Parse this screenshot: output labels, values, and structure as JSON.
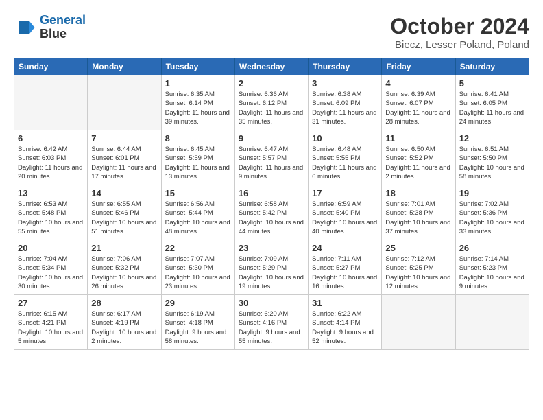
{
  "header": {
    "logo_line1": "General",
    "logo_line2": "Blue",
    "month": "October 2024",
    "location": "Biecz, Lesser Poland, Poland"
  },
  "weekdays": [
    "Sunday",
    "Monday",
    "Tuesday",
    "Wednesday",
    "Thursday",
    "Friday",
    "Saturday"
  ],
  "weeks": [
    [
      {
        "day": "",
        "info": ""
      },
      {
        "day": "",
        "info": ""
      },
      {
        "day": "1",
        "info": "Sunrise: 6:35 AM\nSunset: 6:14 PM\nDaylight: 11 hours and 39 minutes."
      },
      {
        "day": "2",
        "info": "Sunrise: 6:36 AM\nSunset: 6:12 PM\nDaylight: 11 hours and 35 minutes."
      },
      {
        "day": "3",
        "info": "Sunrise: 6:38 AM\nSunset: 6:09 PM\nDaylight: 11 hours and 31 minutes."
      },
      {
        "day": "4",
        "info": "Sunrise: 6:39 AM\nSunset: 6:07 PM\nDaylight: 11 hours and 28 minutes."
      },
      {
        "day": "5",
        "info": "Sunrise: 6:41 AM\nSunset: 6:05 PM\nDaylight: 11 hours and 24 minutes."
      }
    ],
    [
      {
        "day": "6",
        "info": "Sunrise: 6:42 AM\nSunset: 6:03 PM\nDaylight: 11 hours and 20 minutes."
      },
      {
        "day": "7",
        "info": "Sunrise: 6:44 AM\nSunset: 6:01 PM\nDaylight: 11 hours and 17 minutes."
      },
      {
        "day": "8",
        "info": "Sunrise: 6:45 AM\nSunset: 5:59 PM\nDaylight: 11 hours and 13 minutes."
      },
      {
        "day": "9",
        "info": "Sunrise: 6:47 AM\nSunset: 5:57 PM\nDaylight: 11 hours and 9 minutes."
      },
      {
        "day": "10",
        "info": "Sunrise: 6:48 AM\nSunset: 5:55 PM\nDaylight: 11 hours and 6 minutes."
      },
      {
        "day": "11",
        "info": "Sunrise: 6:50 AM\nSunset: 5:52 PM\nDaylight: 11 hours and 2 minutes."
      },
      {
        "day": "12",
        "info": "Sunrise: 6:51 AM\nSunset: 5:50 PM\nDaylight: 10 hours and 58 minutes."
      }
    ],
    [
      {
        "day": "13",
        "info": "Sunrise: 6:53 AM\nSunset: 5:48 PM\nDaylight: 10 hours and 55 minutes."
      },
      {
        "day": "14",
        "info": "Sunrise: 6:55 AM\nSunset: 5:46 PM\nDaylight: 10 hours and 51 minutes."
      },
      {
        "day": "15",
        "info": "Sunrise: 6:56 AM\nSunset: 5:44 PM\nDaylight: 10 hours and 48 minutes."
      },
      {
        "day": "16",
        "info": "Sunrise: 6:58 AM\nSunset: 5:42 PM\nDaylight: 10 hours and 44 minutes."
      },
      {
        "day": "17",
        "info": "Sunrise: 6:59 AM\nSunset: 5:40 PM\nDaylight: 10 hours and 40 minutes."
      },
      {
        "day": "18",
        "info": "Sunrise: 7:01 AM\nSunset: 5:38 PM\nDaylight: 10 hours and 37 minutes."
      },
      {
        "day": "19",
        "info": "Sunrise: 7:02 AM\nSunset: 5:36 PM\nDaylight: 10 hours and 33 minutes."
      }
    ],
    [
      {
        "day": "20",
        "info": "Sunrise: 7:04 AM\nSunset: 5:34 PM\nDaylight: 10 hours and 30 minutes."
      },
      {
        "day": "21",
        "info": "Sunrise: 7:06 AM\nSunset: 5:32 PM\nDaylight: 10 hours and 26 minutes."
      },
      {
        "day": "22",
        "info": "Sunrise: 7:07 AM\nSunset: 5:30 PM\nDaylight: 10 hours and 23 minutes."
      },
      {
        "day": "23",
        "info": "Sunrise: 7:09 AM\nSunset: 5:29 PM\nDaylight: 10 hours and 19 minutes."
      },
      {
        "day": "24",
        "info": "Sunrise: 7:11 AM\nSunset: 5:27 PM\nDaylight: 10 hours and 16 minutes."
      },
      {
        "day": "25",
        "info": "Sunrise: 7:12 AM\nSunset: 5:25 PM\nDaylight: 10 hours and 12 minutes."
      },
      {
        "day": "26",
        "info": "Sunrise: 7:14 AM\nSunset: 5:23 PM\nDaylight: 10 hours and 9 minutes."
      }
    ],
    [
      {
        "day": "27",
        "info": "Sunrise: 6:15 AM\nSunset: 4:21 PM\nDaylight: 10 hours and 5 minutes."
      },
      {
        "day": "28",
        "info": "Sunrise: 6:17 AM\nSunset: 4:19 PM\nDaylight: 10 hours and 2 minutes."
      },
      {
        "day": "29",
        "info": "Sunrise: 6:19 AM\nSunset: 4:18 PM\nDaylight: 9 hours and 58 minutes."
      },
      {
        "day": "30",
        "info": "Sunrise: 6:20 AM\nSunset: 4:16 PM\nDaylight: 9 hours and 55 minutes."
      },
      {
        "day": "31",
        "info": "Sunrise: 6:22 AM\nSunset: 4:14 PM\nDaylight: 9 hours and 52 minutes."
      },
      {
        "day": "",
        "info": ""
      },
      {
        "day": "",
        "info": ""
      }
    ]
  ]
}
